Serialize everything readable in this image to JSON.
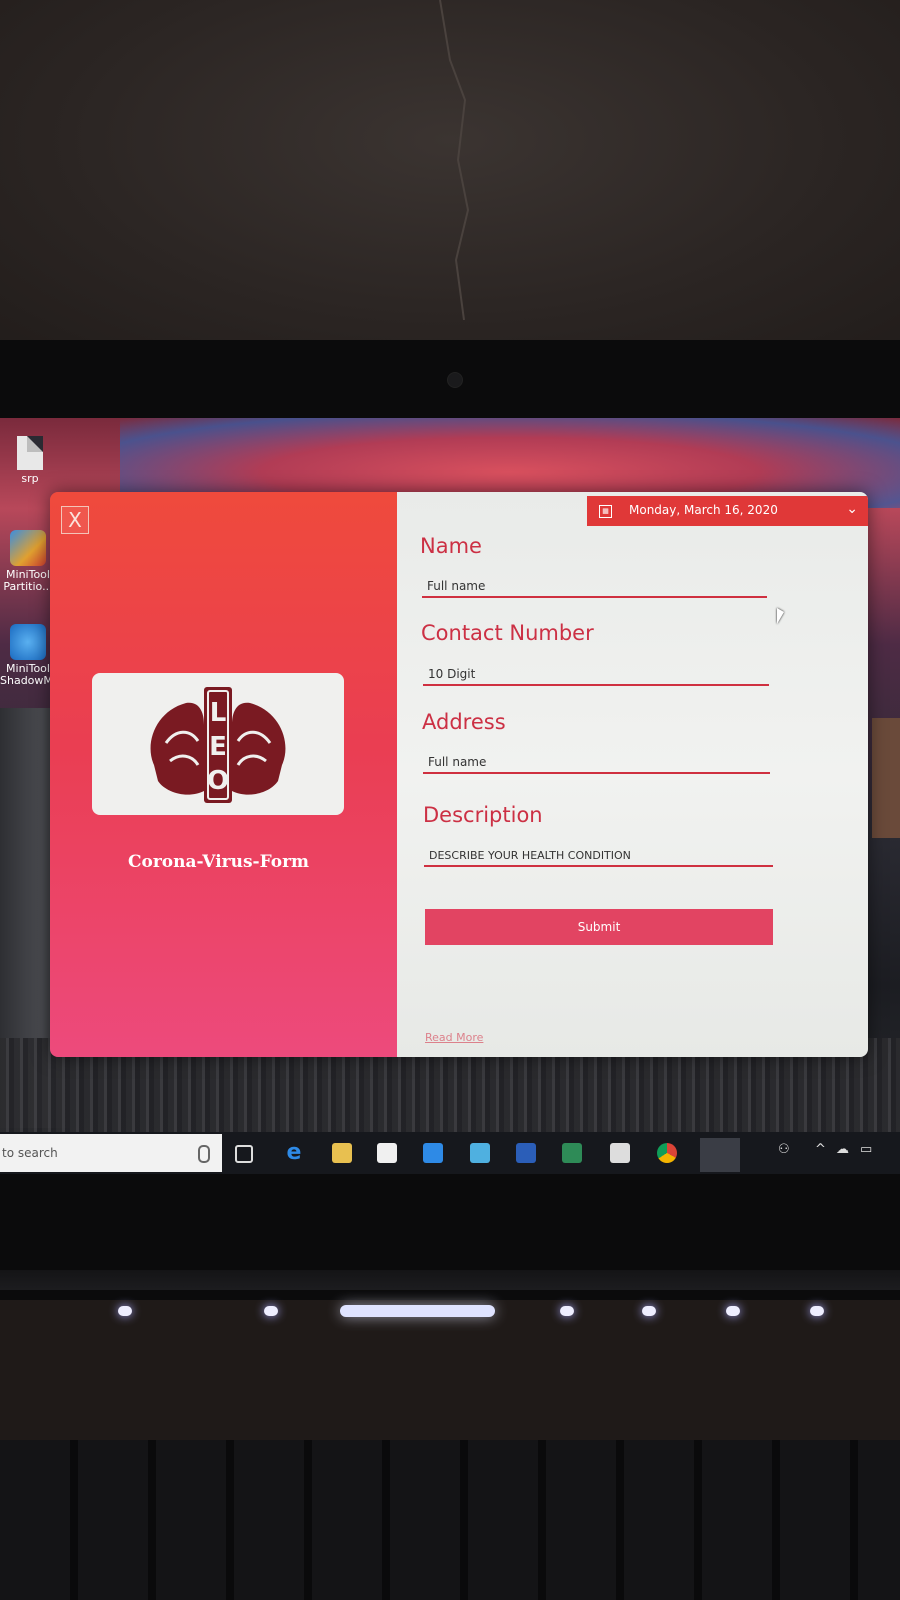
{
  "desktop": {
    "icons": [
      {
        "label": "srp"
      },
      {
        "label": "MiniTool Partitio..."
      },
      {
        "label": "MiniTool ShadowMa"
      }
    ]
  },
  "form": {
    "close_label": "X",
    "title": "Corona-Virus-Form",
    "logo_text": "LEO",
    "date": "Monday, March 16, 2020",
    "fields": {
      "name": {
        "label": "Name",
        "placeholder": "Full name"
      },
      "contact": {
        "label": "Contact Number",
        "placeholder": "10 Digit"
      },
      "address": {
        "label": "Address",
        "placeholder": "Full name"
      },
      "description": {
        "label": "Description",
        "placeholder": "DESCRIBE YOUR HEALTH CONDITION"
      }
    },
    "submit_label": "Submit",
    "read_more_label": "Read More"
  },
  "taskbar": {
    "search_placeholder": "to search"
  },
  "colors": {
    "accent": "#e03838",
    "label": "#cc3044",
    "left_panel_top": "#ef4a3c",
    "left_panel_bottom": "#ed4a7c",
    "logo_maroon": "#7a1a22"
  }
}
